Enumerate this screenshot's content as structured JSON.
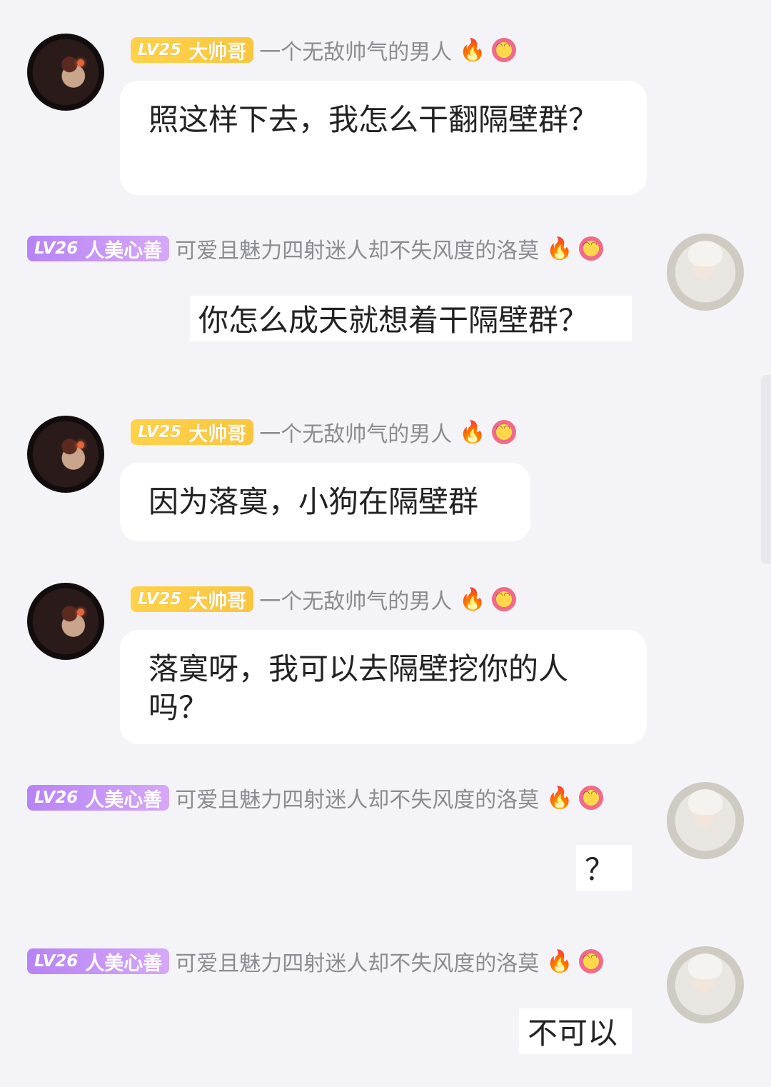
{
  "users": {
    "left": {
      "level": "LV25",
      "title": "大帅哥",
      "nickname": "一个无敌帅气的男人"
    },
    "right": {
      "level": "LV26",
      "title": "人美心善",
      "nickname": "可爱且魅力四射迷人却不失风度的洛莫"
    }
  },
  "icons": {
    "fire": "fire-icon",
    "flower": "flower-icon"
  },
  "messages": [
    {
      "side": "left",
      "text": "照这样下去，我怎么干翻隔壁群？"
    },
    {
      "side": "right",
      "text": "你怎么成天就想着干隔壁群？"
    },
    {
      "side": "left",
      "text": "因为落寞，小狗在隔壁群"
    },
    {
      "side": "left",
      "text": "落寞呀，我可以去隔壁挖你的人吗？"
    },
    {
      "side": "right",
      "text": "？"
    },
    {
      "side": "right",
      "text": "不可以"
    }
  ],
  "colors": {
    "background": "#f4f4f8",
    "gold_badge": "#f9c640",
    "purple_badge": "#c08ef6",
    "nickname": "#8b8b93"
  }
}
